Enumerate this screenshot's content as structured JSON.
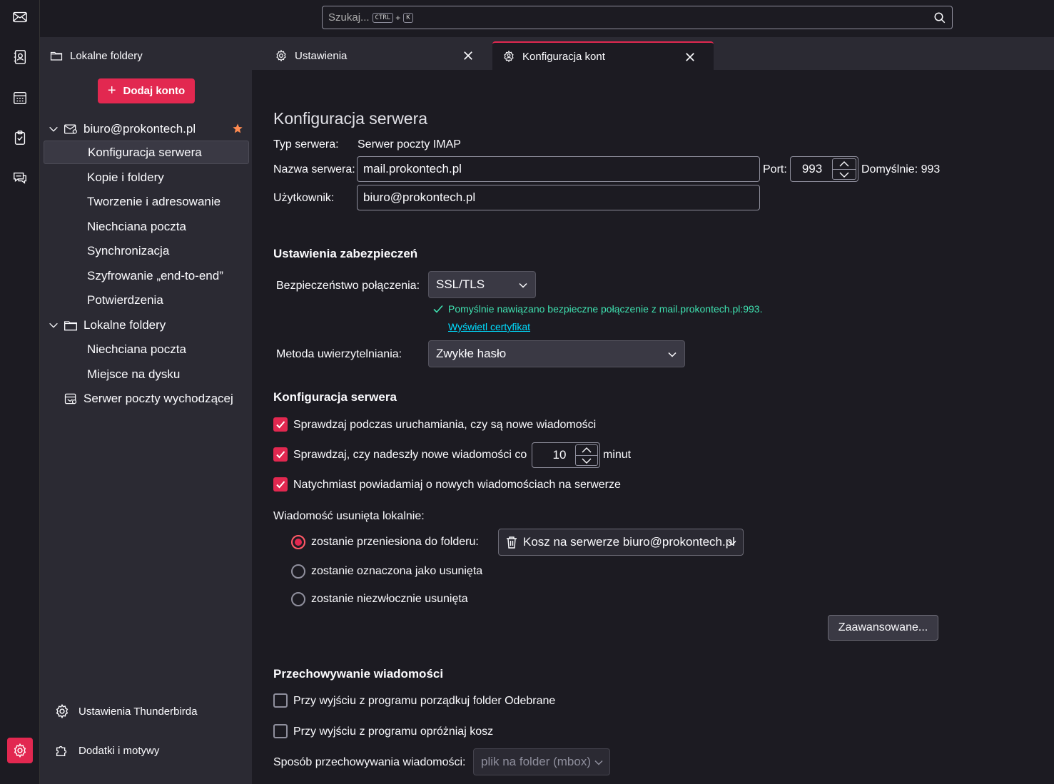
{
  "search": {
    "placeholder": "Szukaj...",
    "shortcut_key1": "CTRL",
    "shortcut_plus": "+",
    "shortcut_key2": "K"
  },
  "tabs": [
    {
      "label": "Lokalne foldery",
      "icon": "folder-icon"
    },
    {
      "label": "Ustawienia",
      "icon": "gear-icon"
    },
    {
      "label": "Konfiguracja kont",
      "icon": "account-settings-icon",
      "active": true
    }
  ],
  "sidebar": {
    "add_account": "Dodaj konto",
    "account": {
      "label": "biuro@prokontech.pl",
      "starred": true
    },
    "account_items": [
      "Konfiguracja serwera",
      "Kopie i foldery",
      "Tworzenie i adresowanie",
      "Niechciana poczta",
      "Synchronizacja",
      "Szyfrowanie „end-to-end”",
      "Potwierdzenia"
    ],
    "local": {
      "label": "Lokalne foldery"
    },
    "local_items": [
      "Niechciana poczta",
      "Miejsce na dysku"
    ],
    "smtp": "Serwer poczty wychodzącej",
    "footer": {
      "thunderbird_settings": "Ustawienia Thunderbirda",
      "addons": "Dodatki i motywy"
    }
  },
  "main": {
    "title": "Konfiguracja serwera",
    "server_type_label": "Typ serwera:",
    "server_type_value": "Serwer poczty IMAP",
    "server_name_label": "Nazwa serwera:",
    "server_name_value": "mail.prokontech.pl",
    "port_label": "Port:",
    "port_value": "993",
    "port_default": "Domyślnie: 993",
    "user_label": "Użytkownik:",
    "user_value": "biuro@prokontech.pl",
    "security": {
      "heading": "Ustawienia zabezpieczeń",
      "connection_label": "Bezpieczeństwo połączenia:",
      "connection_value": "SSL/TLS",
      "success_message": "Pomyślnie nawiązano bezpieczne połączenie z mail.prokontech.pl:993.",
      "view_certificate": "Wyświetl certyfikat",
      "auth_label": "Metoda uwierzytelniania:",
      "auth_value": "Zwykłe hasło"
    },
    "server_settings": {
      "heading": "Konfiguracja serwera",
      "check_on_startup": {
        "label": "Sprawdzaj podczas uruchamiania, czy są nowe wiadomości",
        "checked": true
      },
      "check_every": {
        "label_before": "Sprawdzaj, czy nadeszły nowe wiadomości co",
        "value": "10",
        "label_after": "minut",
        "checked": true
      },
      "push_notify": {
        "label": "Natychmiast powiadamiaj o nowych wiadomościach na serwerze",
        "checked": true
      },
      "deleted_label": "Wiadomość usunięta lokalnie:",
      "deleted_options": [
        {
          "label": "zostanie przeniesiona do folderu:",
          "selected": true
        },
        {
          "label": "zostanie oznaczona jako usunięta",
          "selected": false
        },
        {
          "label": "zostanie niezwłocznie usunięta",
          "selected": false
        }
      ],
      "trash_folder": "Kosz na serwerze biuro@prokontech.pl",
      "advanced_button": "Zaawansowane..."
    },
    "storage": {
      "heading": "Przechowywanie wiadomości",
      "cleanup_inbox": {
        "label": "Przy wyjściu z programu porządkuj folder Odebrane",
        "checked": false
      },
      "empty_trash": {
        "label": "Przy wyjściu z programu opróżniaj kosz",
        "checked": false
      },
      "storage_type_label": "Sposób przechowywania wiadomości:",
      "storage_type_value": "plik na folder (mbox)"
    }
  },
  "colors": {
    "accent": "#e22850",
    "success": "#3fe1b0",
    "link": "#00ddff",
    "background": "#1c1b22",
    "sidebar": "#2b2a33"
  }
}
